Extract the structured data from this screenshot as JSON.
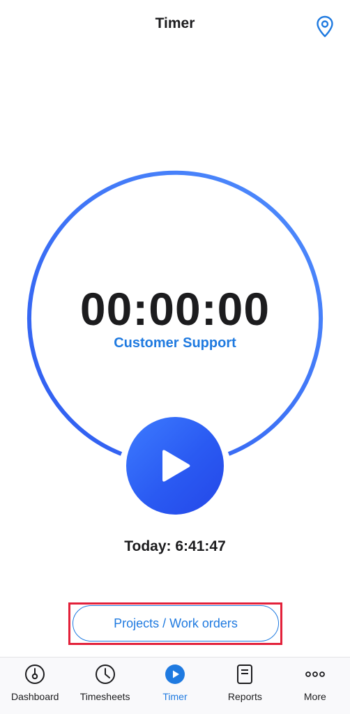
{
  "header": {
    "title": "Timer",
    "location_icon": "map-pin-icon"
  },
  "timer": {
    "elapsed": "00:00:00",
    "project": "Customer Support",
    "play_icon": "play-icon",
    "today": "Today: 6:41:47"
  },
  "actions": {
    "projects_label": "Projects / Work orders"
  },
  "tabbar": {
    "items": [
      {
        "label": "Dashboard",
        "icon": "dashboard-gauge-icon",
        "active": false
      },
      {
        "label": "Timesheets",
        "icon": "clock-icon",
        "active": false
      },
      {
        "label": "Timer",
        "icon": "play-circle-icon",
        "active": true
      },
      {
        "label": "Reports",
        "icon": "document-icon",
        "active": false
      },
      {
        "label": "More",
        "icon": "more-dots-icon",
        "active": false
      }
    ]
  },
  "colors": {
    "accent": "#1f7ae0",
    "ring_start": "#2e5bf0",
    "ring_end": "#4f8dfd",
    "highlight": "#e3213a"
  }
}
